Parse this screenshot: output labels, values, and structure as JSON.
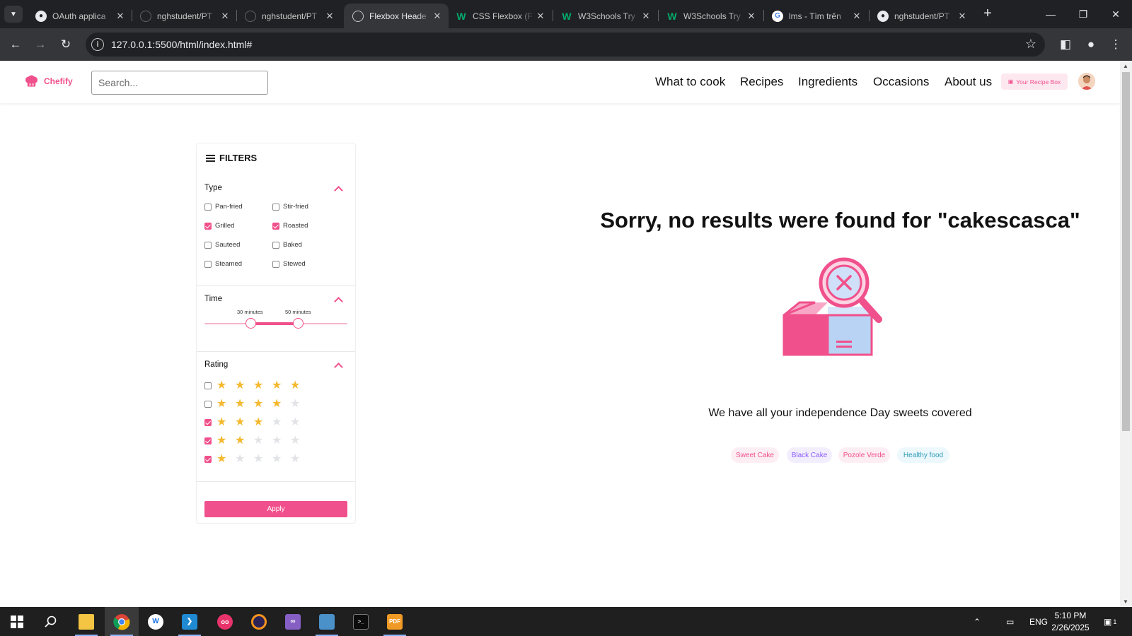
{
  "browser": {
    "tabs": [
      {
        "title": "OAuth applica",
        "icon": "github-icon",
        "active": false
      },
      {
        "title": "nghstudent/PT",
        "icon": "github-icon",
        "active": false
      },
      {
        "title": "nghstudent/PT",
        "icon": "github-icon",
        "active": false
      },
      {
        "title": "Flexbox Heade",
        "icon": "globe-icon",
        "active": true
      },
      {
        "title": "CSS Flexbox (F",
        "icon": "w3schools-icon",
        "active": false
      },
      {
        "title": "W3Schools Try",
        "icon": "w3schools-icon",
        "active": false
      },
      {
        "title": "W3Schools Try",
        "icon": "w3schools-icon",
        "active": false
      },
      {
        "title": "lms - Tìm trên",
        "icon": "google-icon",
        "active": false
      },
      {
        "title": "nghstudent/PT",
        "icon": "github-icon",
        "active": false
      }
    ],
    "url": "127.0.0.1:5500/html/index.html#"
  },
  "site": {
    "brand": "Chefify",
    "search_placeholder": "Search...",
    "nav": [
      "What to cook",
      "Recipes",
      "Ingredients",
      "Occasions",
      "About us"
    ],
    "recipe_box_label": "Your Recipe Box",
    "accent_color": "#f0508b"
  },
  "filters": {
    "title": "FILTERS",
    "type": {
      "title": "Type",
      "options": [
        {
          "label": "Pan-fried",
          "checked": false
        },
        {
          "label": "Stir-fried",
          "checked": false
        },
        {
          "label": "Grilled",
          "checked": true
        },
        {
          "label": "Roasted",
          "checked": true
        },
        {
          "label": "Sauteed",
          "checked": false
        },
        {
          "label": "Baked",
          "checked": false
        },
        {
          "label": "Steamed",
          "checked": false
        },
        {
          "label": "Stewed",
          "checked": false
        }
      ]
    },
    "time": {
      "title": "Time",
      "min_label": "30 minutes",
      "max_label": "50 minutes"
    },
    "rating": {
      "title": "Rating",
      "rows": [
        {
          "stars": 5,
          "checked": false
        },
        {
          "stars": 4,
          "checked": false
        },
        {
          "stars": 3,
          "checked": true
        },
        {
          "stars": 2,
          "checked": true
        },
        {
          "stars": 1,
          "checked": true
        }
      ]
    },
    "apply_label": "Apply"
  },
  "results": {
    "message": "Sorry, no results were found for \"cakescasca\"",
    "sub_message": "We have all your independence Day sweets covered",
    "chips": [
      {
        "label": "Sweet Cake",
        "bg": "#fdeef3",
        "fg": "#f0508b"
      },
      {
        "label": "Black Cake",
        "bg": "#f3eefe",
        "fg": "#8a5cf5"
      },
      {
        "label": "Pozole Verde",
        "bg": "#fdeef3",
        "fg": "#f0508b"
      },
      {
        "label": "Healthy food",
        "bg": "#ecf8fb",
        "fg": "#2d9bb8"
      }
    ]
  },
  "taskbar": {
    "apps": [
      "start-icon",
      "search-icon",
      "file-explorer-icon",
      "chrome-icon",
      "app-icon",
      "vscode-icon",
      "app-icon",
      "eclipse-icon",
      "visual-studio-icon",
      "app-icon",
      "terminal-icon",
      "pdf-icon"
    ],
    "language": "ENG",
    "time": "5:10 PM",
    "date": "2/26/2025",
    "notification_count": "1"
  }
}
